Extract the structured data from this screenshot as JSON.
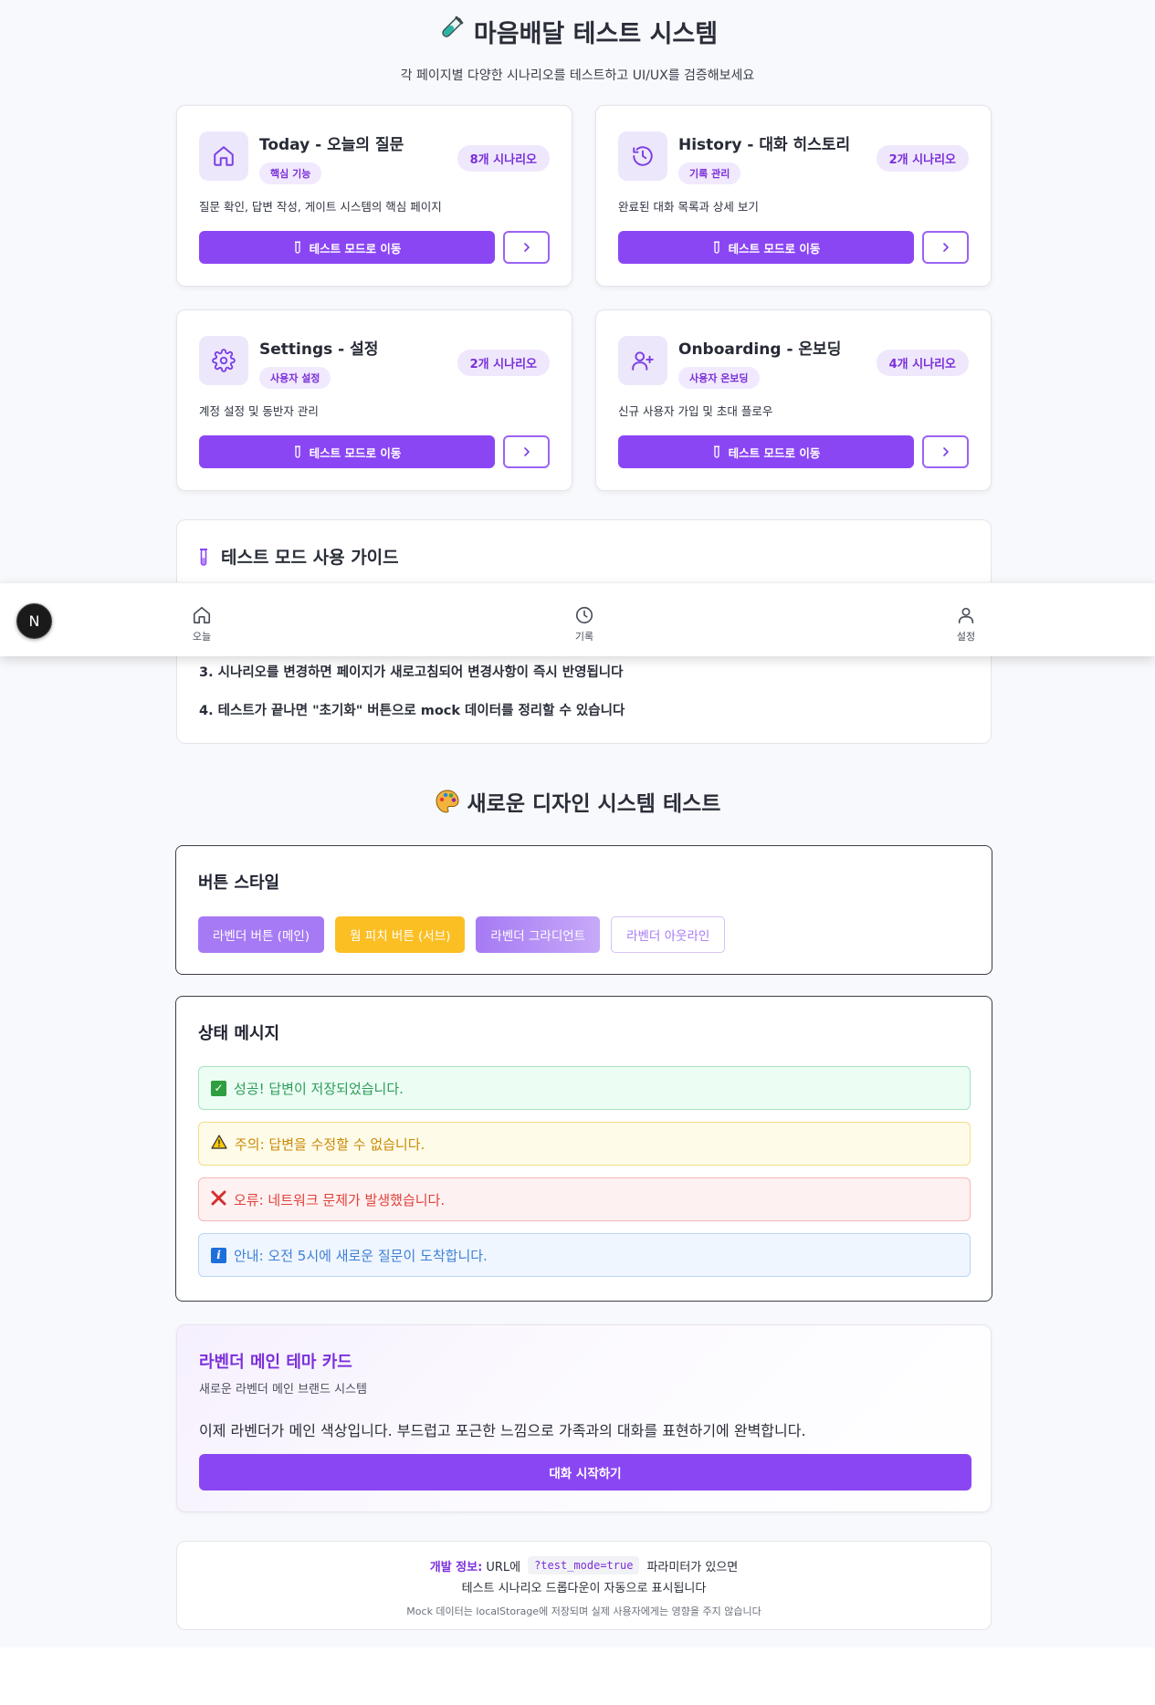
{
  "header": {
    "title": "마음배달 테스트 시스템",
    "subtitle": "각 페이지별 다양한 시나리오를 테스트하고 UI/UX를 검증해보세요"
  },
  "cards": [
    {
      "title": "Today - 오늘의 질문",
      "tag": "핵심 기능",
      "badge": "8개 시나리오",
      "desc": "질문 확인, 답변 작성, 게이트 시스템의 핵심 페이지",
      "button": "테스트 모드로 이동",
      "icon": "home-icon"
    },
    {
      "title": "History - 대화 히스토리",
      "tag": "기록 관리",
      "badge": "2개 시나리오",
      "desc": "완료된 대화 목록과 상세 보기",
      "button": "테스트 모드로 이동",
      "icon": "history-icon"
    },
    {
      "title": "Settings - 설정",
      "tag": "사용자 설정",
      "badge": "2개 시나리오",
      "desc": "계정 설정 및 동반자 관리",
      "button": "테스트 모드로 이동",
      "icon": "gear-icon"
    },
    {
      "title": "Onboarding - 온보딩",
      "tag": "사용자 온보딩",
      "badge": "4개 시나리오",
      "desc": "신규 사용자 가입 및 초대 플로우",
      "button": "테스트 모드로 이동",
      "icon": "user-plus-icon"
    }
  ],
  "guide": {
    "title": "테스트 모드 사용 가이드",
    "items": [
      "3.  시나리오를 변경하면 페이지가 새로고침되어 변경사항이 즉시 반영됩니다",
      "4.  테스트가 끝나면 \"초기화\" 버튼으로 mock 데이터를 정리할 수 있습니다"
    ]
  },
  "nav": {
    "badge": "N",
    "items": [
      {
        "label": "오늘",
        "icon": "home-icon"
      },
      {
        "label": "기록",
        "icon": "clock-icon"
      },
      {
        "label": "설정",
        "icon": "user-icon"
      }
    ]
  },
  "design": {
    "title": "새로운 디자인 시스템 테스트",
    "buttons_title": "버튼 스타일",
    "buttons": [
      "라벤더 버튼 (메인)",
      "웜 피치 버튼 (서브)",
      "라벤더 그라디언트",
      "라벤더 아웃라인"
    ],
    "status_title": "상태 메시지",
    "alerts": {
      "success": "성공! 답변이 저장되었습니다.",
      "warning": "주의: 답변을 수정할 수 없습니다.",
      "error": "오류: 네트워크 문제가 발생했습니다.",
      "info": "안내: 오전 5시에 새로운 질문이 도착합니다."
    }
  },
  "theme_card": {
    "title": "라벤더 메인 테마 카드",
    "subtitle": "새로운 라벤더 메인 브랜드 시스템",
    "body": "이제 라벤더가 메인 색상입니다. 부드럽고 포근한 느낌으로 가족과의 대화를 표현하기에 완벽합니다.",
    "button": "대화 시작하기"
  },
  "dev": {
    "label": "개발 정보:",
    "pre": "URL에",
    "code": "?test_mode=true",
    "post": "파라미터가 있으면",
    "line2": "테스트 시나리오 드롭다운이 자동으로 표시됩니다",
    "line3": "Mock 데이터는 localStorage에 저장되며 실제 사용자에게는 영향을 주지 않습니다"
  },
  "colors": {
    "primary": "#8b46f4",
    "primary_light": "#a67af4",
    "peach": "#fbbf24",
    "success_bg": "#ecfdf3",
    "warning_bg": "#fefbe8",
    "error_bg": "#fef1f1",
    "info_bg": "#eff6ff"
  }
}
